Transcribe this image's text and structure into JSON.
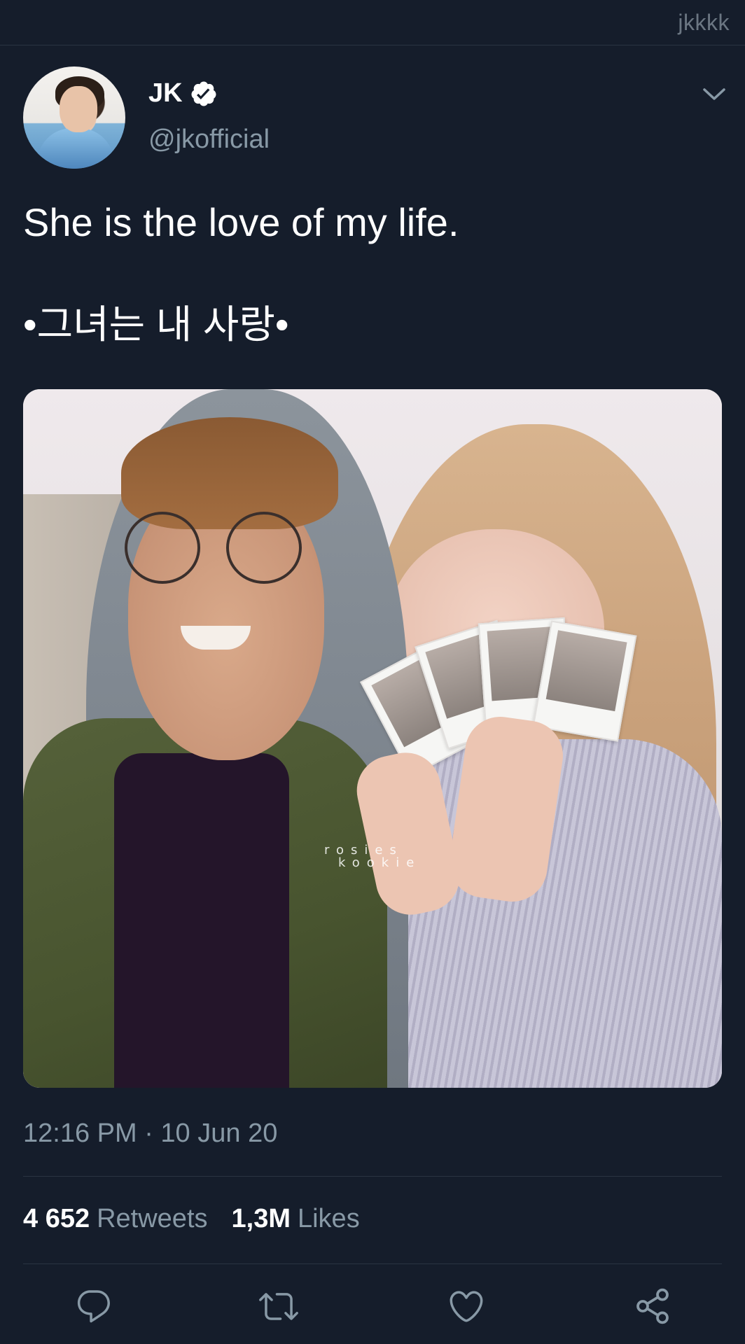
{
  "topbar": {
    "watermark": "jkkkk"
  },
  "tweet": {
    "author_name": "JK",
    "author_handle": "@jkofficial",
    "verified": true,
    "text_line1": "She is the love of my life.",
    "text_line2": "•그녀는 내 사랑•",
    "media_watermark_line1": "rosies",
    "media_watermark_line2": "kookie",
    "timestamp": "12:16 PM · 10 Jun 20",
    "retweets_count": "4 652",
    "retweets_label": "Retweets",
    "likes_count": "1,3M",
    "likes_label": "Likes"
  },
  "icons": {
    "verified": "verified-badge-icon",
    "more": "chevron-down-icon",
    "reply": "reply-icon",
    "retweet": "retweet-icon",
    "like": "heart-icon",
    "share": "share-icon"
  },
  "colors": {
    "background": "#151d2b",
    "secondary_text": "#8899a6",
    "divider": "#2a3442",
    "primary_text": "#ffffff"
  }
}
